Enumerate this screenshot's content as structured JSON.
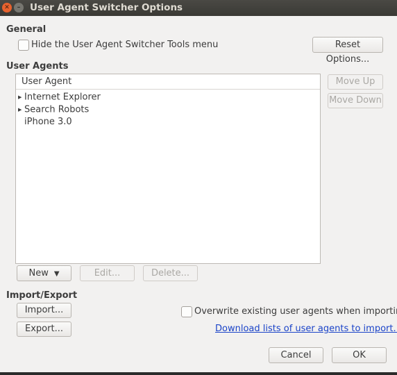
{
  "window": {
    "title": "User Agent Switcher Options"
  },
  "general": {
    "heading": "General",
    "hide_menu_label": "Hide the User Agent Switcher Tools menu",
    "reset_button": "Reset Options..."
  },
  "user_agents": {
    "heading": "User Agents",
    "column_header": "User Agent",
    "items": [
      {
        "label": "Internet Explorer",
        "expandable": true
      },
      {
        "label": "Search Robots",
        "expandable": true
      },
      {
        "label": "iPhone 3.0",
        "expandable": false
      }
    ],
    "move_up": "Move Up",
    "move_down": "Move Down",
    "new_button": "New",
    "edit_button": "Edit...",
    "delete_button": "Delete..."
  },
  "import_export": {
    "heading": "Import/Export",
    "import_button": "Import...",
    "export_button": "Export...",
    "overwrite_label": "Overwrite existing user agents when importing",
    "download_link": "Download lists of user agents to import..."
  },
  "footer": {
    "cancel": "Cancel",
    "ok": "OK"
  },
  "colors": {
    "link": "#1a43c8",
    "close_button": "#e8622e",
    "titlebar": "#3a3935"
  }
}
